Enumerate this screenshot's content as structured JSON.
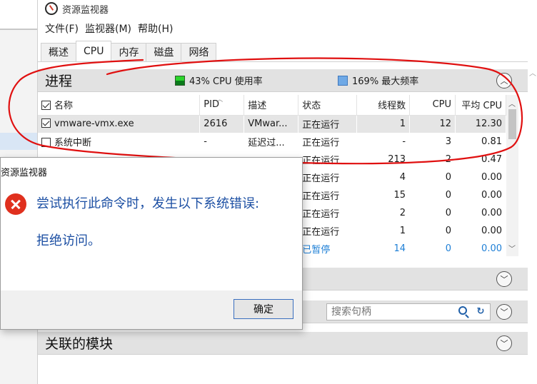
{
  "window": {
    "title": "资源监视器"
  },
  "menu": [
    "文件(F)",
    "监视器(M)",
    "帮助(H)"
  ],
  "tabs": [
    "概述",
    "CPU",
    "内存",
    "磁盘",
    "网络"
  ],
  "processes": {
    "title": "进程",
    "cpu_usage": "43% CPU 使用率",
    "max_freq": "169% 最大频率",
    "columns": [
      "名称",
      "PID",
      "描述",
      "状态",
      "线程数",
      "CPU",
      "平均 CPU"
    ],
    "rows": [
      {
        "name": "vmware-vmx.exe",
        "checked": true,
        "pid": "2616",
        "desc": "VMwar...",
        "status": "正在运行",
        "threads": "1",
        "cpu": "12",
        "avg": "12.30"
      },
      {
        "name": "系统中断",
        "checked": false,
        "pid": "-",
        "desc": "延迟过...",
        "status": "正在运行",
        "threads": "-",
        "cpu": "3",
        "avg": "0.81"
      },
      {
        "name": "",
        "checked": false,
        "pid": "",
        "desc": "",
        "status": "正在运行",
        "threads": "213",
        "cpu": "2",
        "avg": "0.47"
      },
      {
        "name": "",
        "checked": false,
        "pid": "",
        "desc": "",
        "status": "正在运行",
        "threads": "4",
        "cpu": "0",
        "avg": "0.00"
      },
      {
        "name": "",
        "checked": false,
        "pid": "",
        "desc": "",
        "status": "正在运行",
        "threads": "15",
        "cpu": "0",
        "avg": "0.00"
      },
      {
        "name": "",
        "checked": false,
        "pid": "",
        "desc": "",
        "status": "正在运行",
        "threads": "2",
        "cpu": "0",
        "avg": "0.00"
      },
      {
        "name": "",
        "checked": false,
        "pid": "",
        "desc": "",
        "status": "正在运行",
        "threads": "1",
        "cpu": "0",
        "avg": "0.00"
      },
      {
        "name": "",
        "checked": false,
        "pid": "",
        "desc": "",
        "status": "已暂停",
        "threads": "14",
        "cpu": "0",
        "avg": "0.00"
      }
    ]
  },
  "handles": {
    "search_placeholder": "搜索句柄"
  },
  "modules": {
    "title": "关联的模块"
  },
  "dialog": {
    "title": "资源监视器",
    "message": "尝试执行此命令时，发生以下系统错误:",
    "detail": "拒绝访问。",
    "ok_label": "确定"
  },
  "colors": {
    "annotation": "#e01010",
    "dialog_text": "#1c4fa3",
    "suspended_text": "#1e7fd6"
  }
}
